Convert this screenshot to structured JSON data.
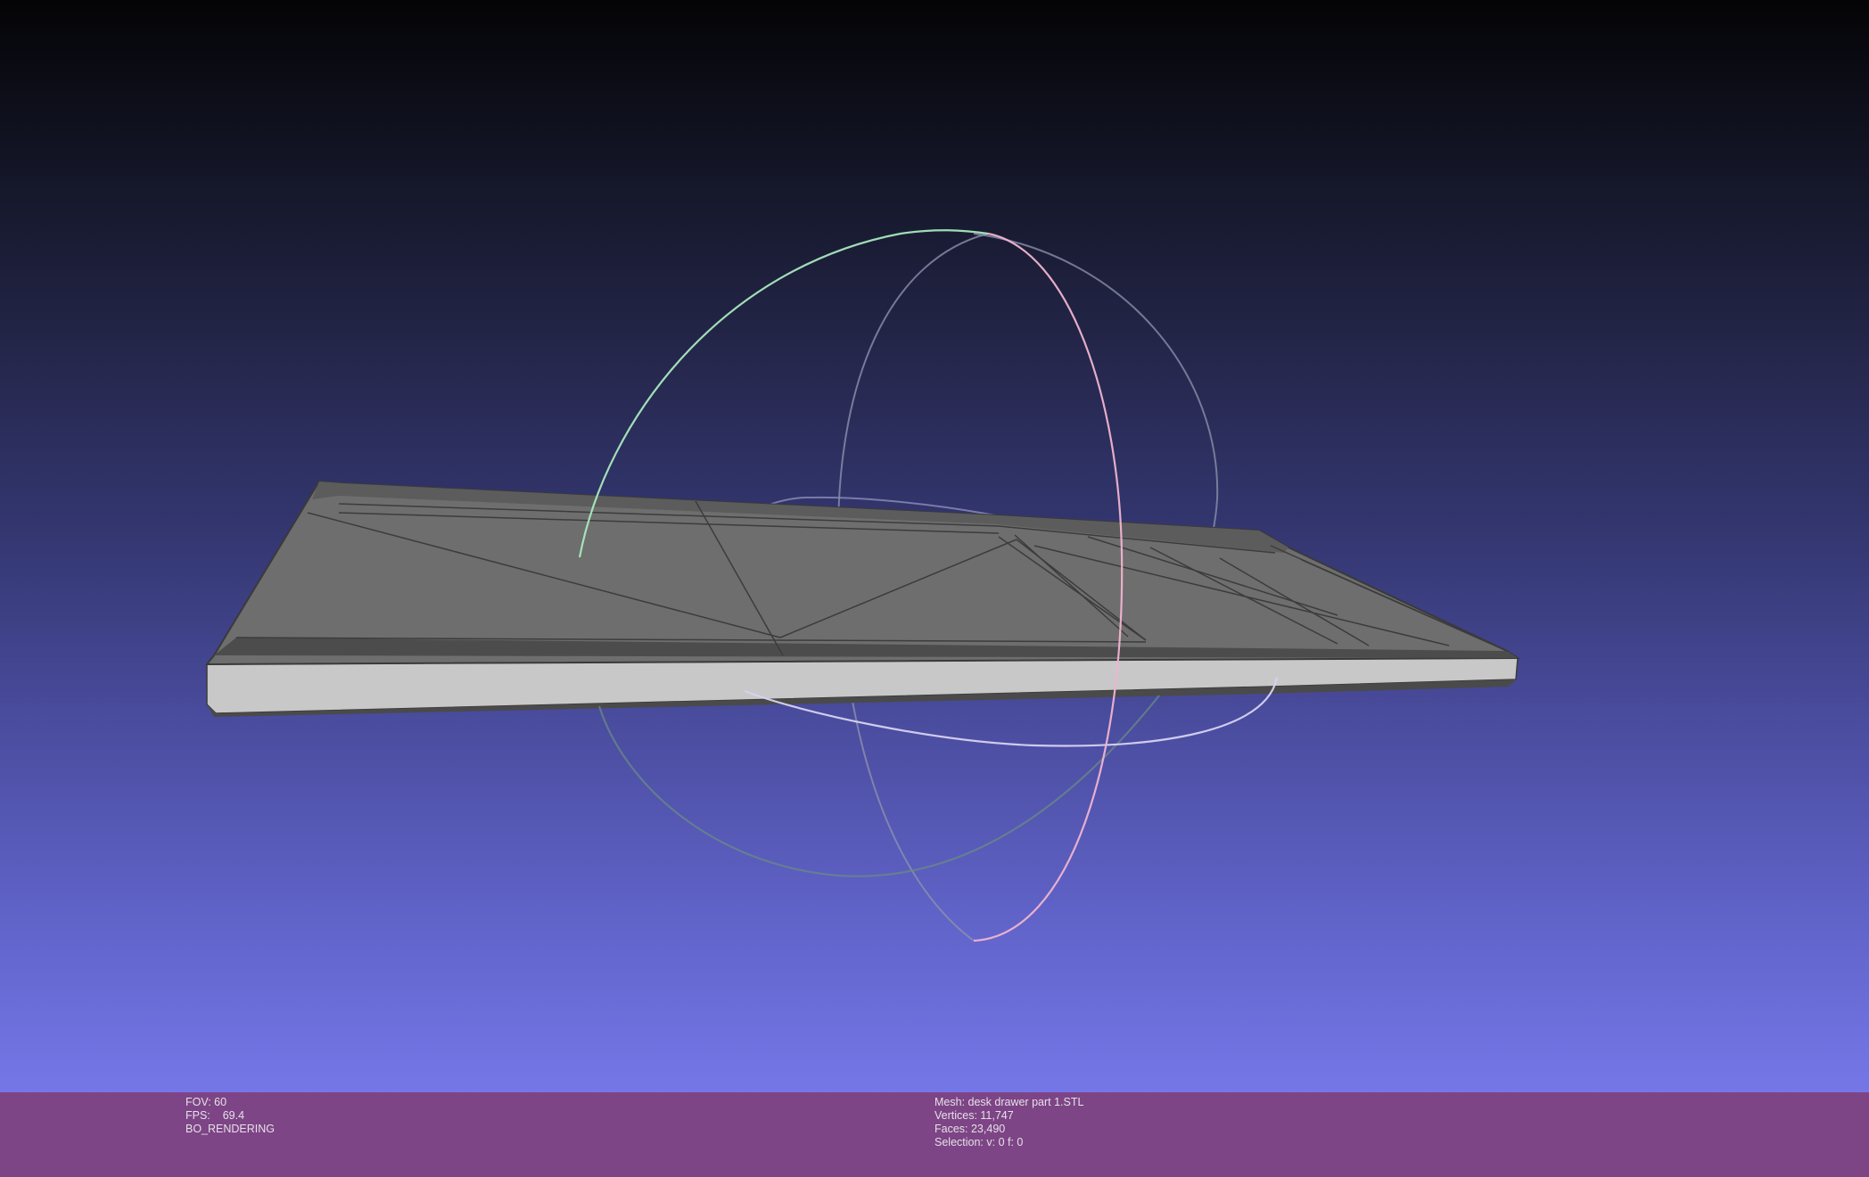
{
  "viewport": {
    "background_top": "#040406",
    "background_bottom": "#7577e8",
    "mesh_colors": {
      "top_face": "#6e6e6e",
      "side_face": "#c4c4c4",
      "edges": "#3a3a3a"
    },
    "trackball_colors": {
      "horizontal_ring": "#d6d2f2",
      "vertical_ring_front": "#f0b4cf",
      "vertical_ring_back": "#9aa0b8",
      "green_ring": "#a8e8be"
    }
  },
  "info_bar": {
    "background": "#7d4585",
    "left": {
      "fov": "FOV: 60",
      "fps_label": "FPS:",
      "fps_value": "69.4",
      "render_mode": "BO_RENDERING"
    },
    "right": {
      "mesh": "Mesh: desk drawer part 1.STL",
      "vertices": "Vertices: 11,747",
      "faces": "Faces: 23,490",
      "selection": "Selection: v: 0 f: 0"
    }
  }
}
